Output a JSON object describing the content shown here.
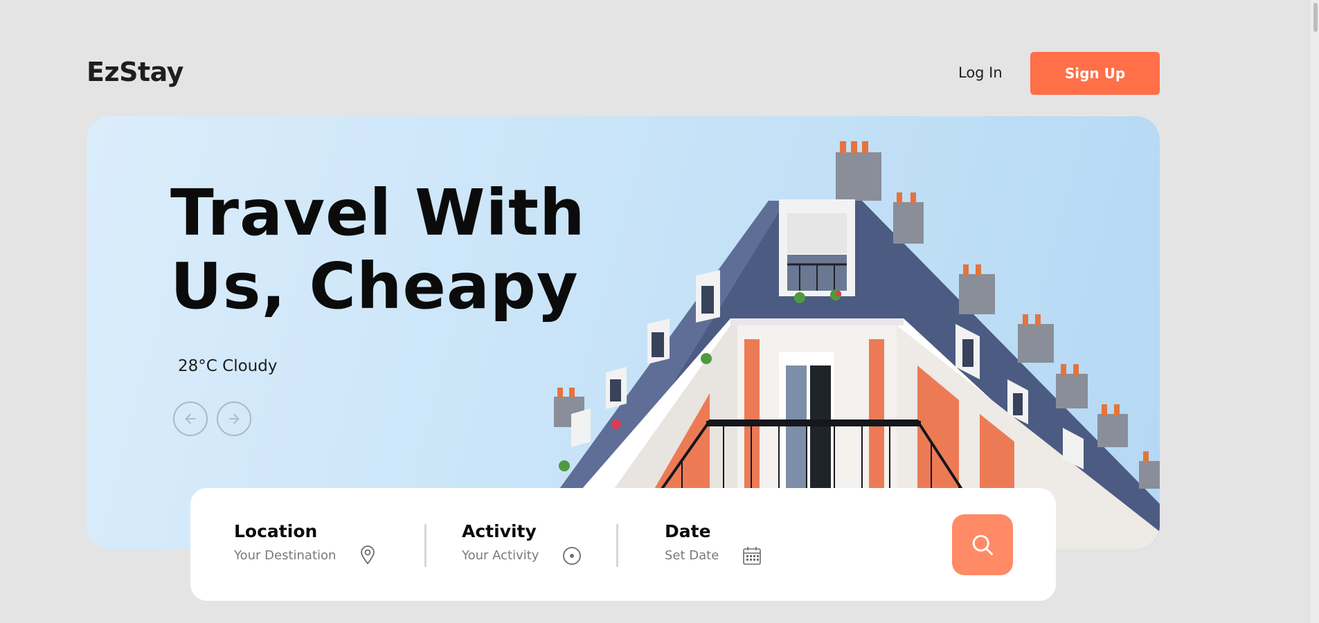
{
  "header": {
    "logo": "EzStay",
    "login_label": "Log In",
    "signup_label": "Sign Up"
  },
  "hero": {
    "headline_line1": "Travel With",
    "headline_line2": "Us, Cheapy",
    "weather": "28°C Cloudy",
    "prev_icon": "arrow-left-icon",
    "next_icon": "arrow-right-icon"
  },
  "search": {
    "location": {
      "title": "Location",
      "placeholder": "Your Destination",
      "icon": "map-pin-icon"
    },
    "activity": {
      "title": "Activity",
      "placeholder": "Your Activity",
      "icon": "disc-icon"
    },
    "date": {
      "title": "Date",
      "placeholder": "Set Date",
      "icon": "calendar-icon"
    },
    "button_icon": "search-icon"
  },
  "colors": {
    "accent": "#ff6f48",
    "search_button": "#ff8a66",
    "background": "#e4e4e4"
  }
}
